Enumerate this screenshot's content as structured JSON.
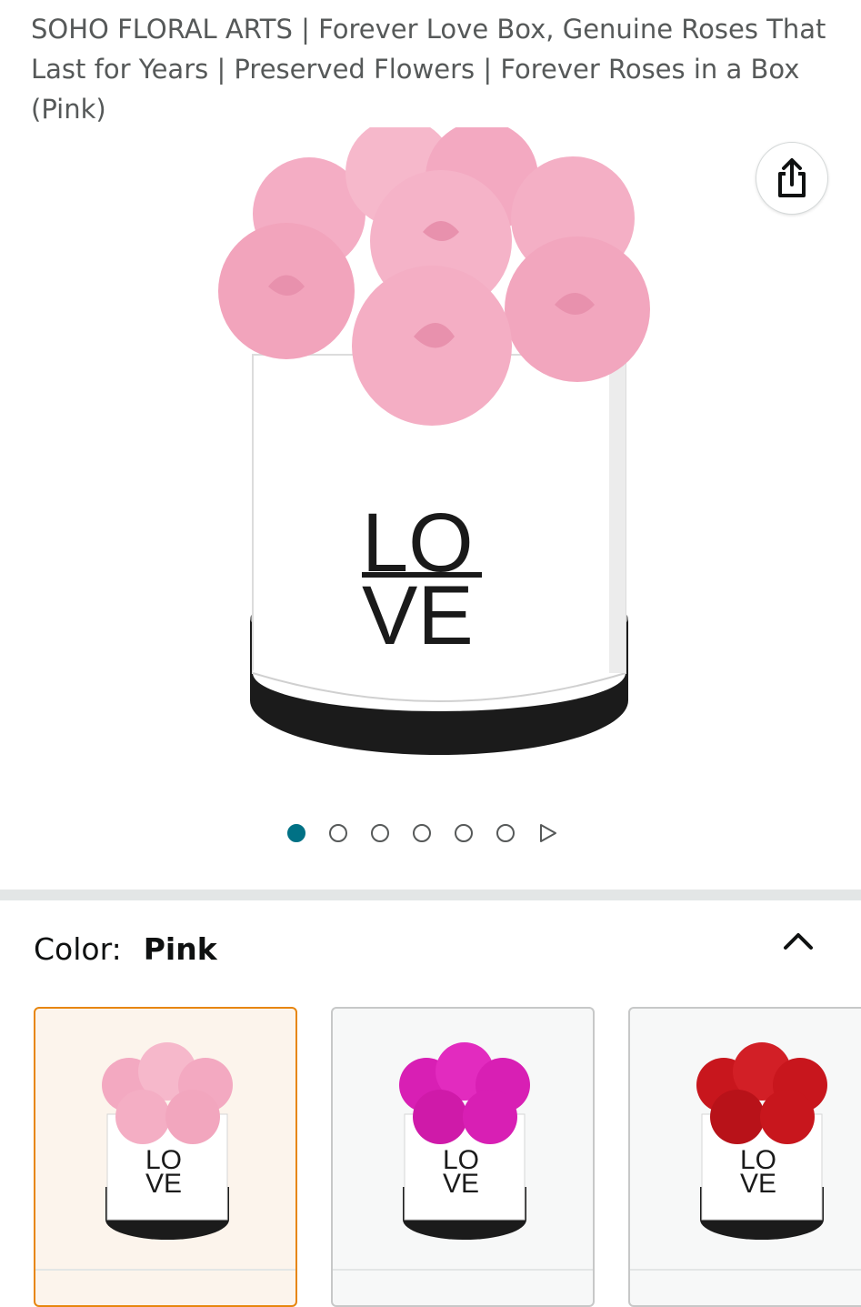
{
  "product": {
    "title": "SOHO FLORAL ARTS | Forever Love Box, Genuine Roses That Last for Years | Preserved Flowers | Forever Roses in a Box (Pink)"
  },
  "share": {
    "icon": "share-icon"
  },
  "hero": {
    "image": "forever-love-box-pink-roses",
    "box_text_line1": "LO",
    "box_text_line2": "VE"
  },
  "carousel": {
    "total_dots": 6,
    "active_index": 0,
    "active_color": "#007185",
    "next_icon": "play-triangle-icon"
  },
  "color_selector": {
    "label": "Color:",
    "selected_value": "Pink",
    "collapse_icon": "chevron-up-icon",
    "options": [
      {
        "name": "Pink",
        "rose_color": "#f3a9c1",
        "selected": true,
        "box_text_line1": "LO",
        "box_text_line2": "VE"
      },
      {
        "name": "Magenta",
        "rose_color": "#d81fb4",
        "selected": false,
        "box_text_line1": "LO",
        "box_text_line2": "VE"
      },
      {
        "name": "Red",
        "rose_color": "#c8161d",
        "selected": false,
        "box_text_line1": "LO",
        "box_text_line2": "VE"
      }
    ]
  },
  "colors": {
    "selected_border": "#e7860f",
    "muted_text": "#565959"
  }
}
